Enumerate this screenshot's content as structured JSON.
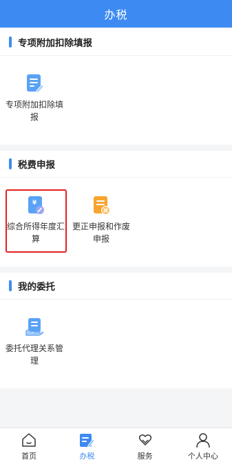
{
  "header": {
    "title": "办税"
  },
  "sections": [
    {
      "title": "专项附加扣除填报",
      "items": [
        {
          "label": "专项附加扣除填报",
          "icon": "document-edit-icon"
        }
      ]
    },
    {
      "title": "税费申报",
      "items": [
        {
          "label": "综合所得年度汇算",
          "icon": "yuan-document-icon",
          "highlighted": true
        },
        {
          "label": "更正申报和作废申报",
          "icon": "document-cancel-icon"
        }
      ]
    },
    {
      "title": "我的委托",
      "items": [
        {
          "label": "委托代理关系管理",
          "icon": "document-hand-icon"
        }
      ]
    }
  ],
  "tabbar": {
    "items": [
      {
        "label": "首页",
        "icon": "home-icon",
        "active": false
      },
      {
        "label": "办税",
        "icon": "tax-edit-icon",
        "active": true
      },
      {
        "label": "服务",
        "icon": "heart-hands-icon",
        "active": false
      },
      {
        "label": "个人中心",
        "icon": "user-icon",
        "active": false
      }
    ]
  },
  "colors": {
    "accent": "#3d8bf2",
    "highlight": "#e01f1f",
    "orange": "#f7a430"
  }
}
